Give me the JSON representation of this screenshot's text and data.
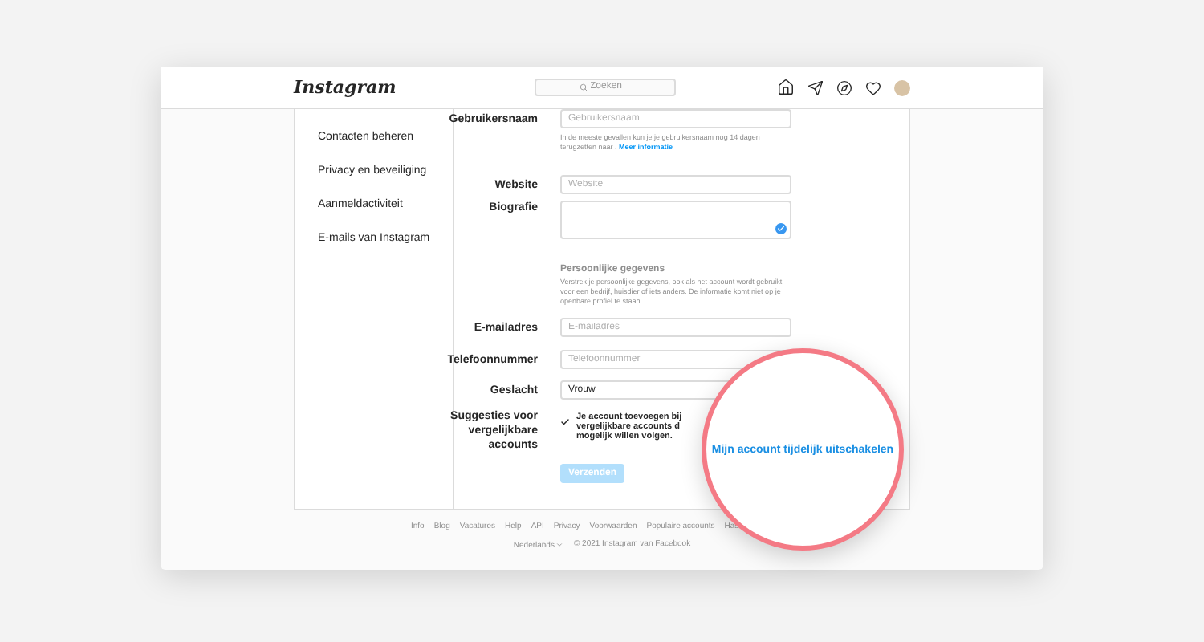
{
  "nav": {
    "logo": "Instagram",
    "search": {
      "placeholder": "Zoeken"
    }
  },
  "sidebar": {
    "items": [
      {
        "label": "Contacten beheren",
        "selected": false
      },
      {
        "label": "Privacy en beveiliging",
        "selected": false
      },
      {
        "label": "Aanmeldactiviteit",
        "selected": false
      },
      {
        "label": "E-mails van Instagram",
        "selected": false
      }
    ]
  },
  "form": {
    "username": {
      "label": "Gebruikersnaam",
      "placeholder": "Gebruikersnaam",
      "hint": "In de meeste gevallen kun je je gebruikersnaam nog 14 dagen terugzetten naar .",
      "hint_link": "Meer informatie"
    },
    "website": {
      "label": "Website",
      "placeholder": "Website"
    },
    "bio": {
      "label": "Biografie",
      "verified": true
    },
    "personal": {
      "title": "Persoonlijke gegevens",
      "text": "Verstrek je persoonlijke gegevens, ook als het account wordt gebruikt voor een bedrijf, huisdier of iets anders. De informatie komt niet op je openbare profiel te staan."
    },
    "email": {
      "label": "E-mailadres",
      "placeholder": "E-mailadres"
    },
    "phone": {
      "label": "Telefoonnummer",
      "placeholder": "Telefoonnummer"
    },
    "gender": {
      "label": "Geslacht",
      "value": "Vrouw"
    },
    "suggestions": {
      "label": "Suggesties voor vergelijkbare accounts",
      "checked": true,
      "lines": [
        "Je account toevoegen bij",
        "vergelijkbare accounts d",
        "mogelijk willen volgen."
      ]
    },
    "submit": {
      "label": "Verzenden",
      "disabled": true
    }
  },
  "magnifier": {
    "link": "Mijn account tijdelijk uitschakelen"
  },
  "footer": {
    "links": [
      "Info",
      "Blog",
      "Vacatures",
      "Help",
      "API",
      "Privacy",
      "Voorwaarden",
      "Populaire accounts",
      "Has"
    ],
    "language": "Nederlands",
    "copyright": "© 2021 Instagram van Facebook"
  }
}
